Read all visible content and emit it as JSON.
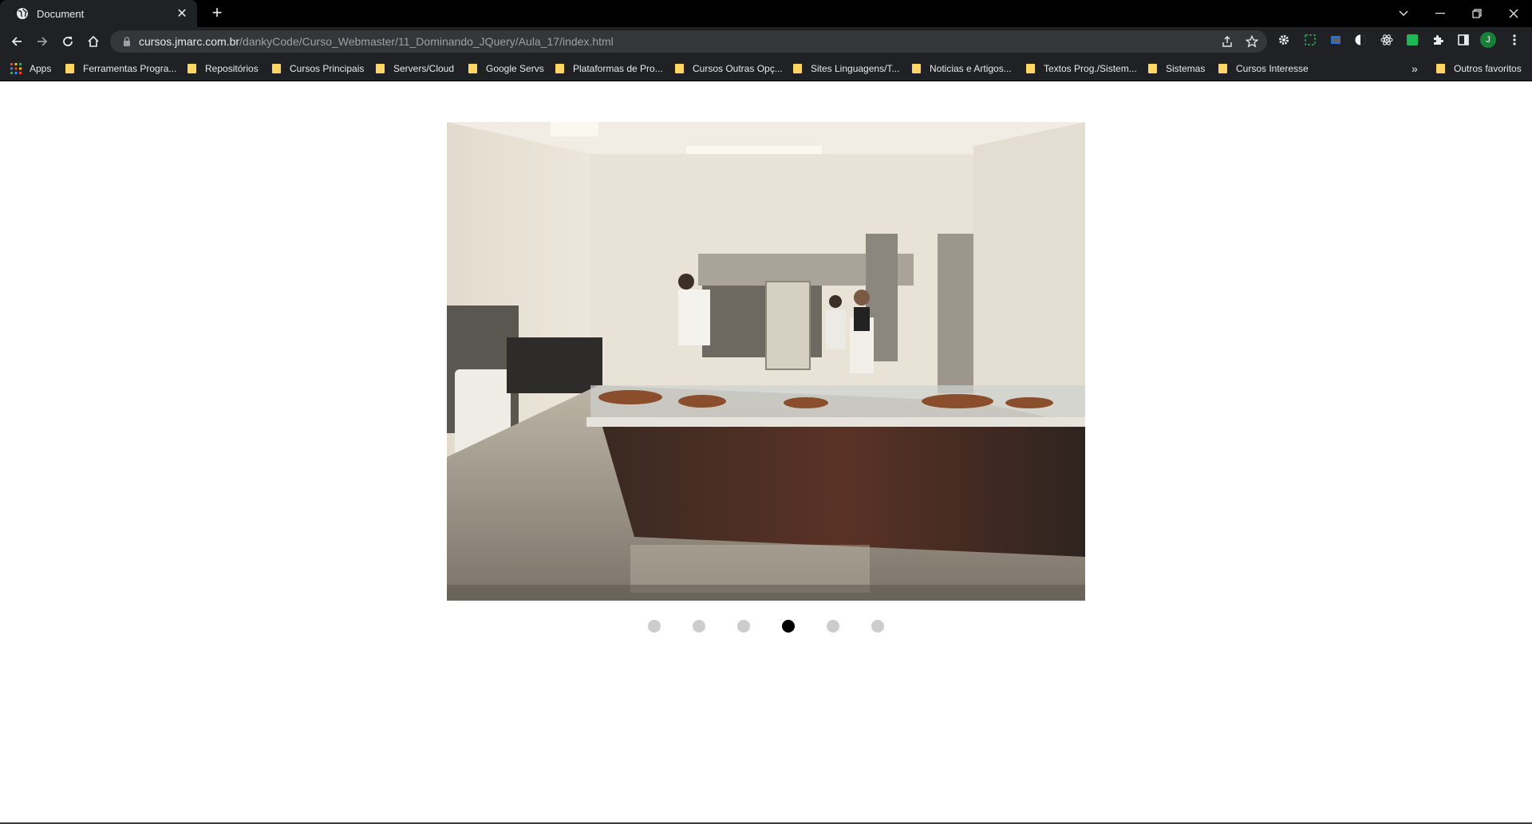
{
  "tab": {
    "title": "Document",
    "favicon": "globe-icon",
    "close_icon": "close-icon"
  },
  "new_tab_icon": "plus-icon",
  "window_controls": {
    "tab_search": "chevron-down-icon",
    "minimize": "minimize-icon",
    "restore": "restore-icon",
    "close": "close-icon"
  },
  "toolbar": {
    "back": "arrow-left-icon",
    "forward": "arrow-right-icon",
    "reload": "reload-icon",
    "home": "home-icon",
    "url_host": "cursos.jmarc.com.br",
    "url_path": "/dankyCode/Curso_Webmaster/11_Dominando_JQuery/Aula_17/index.html",
    "share": "share-icon",
    "bookmark_star": "star-icon",
    "profile_initial": "J"
  },
  "bookmarks": {
    "apps_label": "Apps",
    "items": [
      "Ferramentas Progra...",
      "Repositórios",
      "Cursos Principais",
      "Servers/Cloud",
      "Google Servs",
      "Plataformas de Pro...",
      "Cursos Outras Opç...",
      "Sites Linguagens/T...",
      "Noticias e Artigos...",
      "Textos Prog./Sistem...",
      "Sistemas",
      "Cursos Interesse"
    ],
    "overflow": "»",
    "other": "Outros favoritos"
  },
  "slider": {
    "image": "bakery-kitchen-photo",
    "dot_count": 6,
    "active_index": 3
  },
  "colors": {
    "dot_inactive": "#cccccc",
    "dot_active": "#000000",
    "folder": "#fdd663"
  }
}
